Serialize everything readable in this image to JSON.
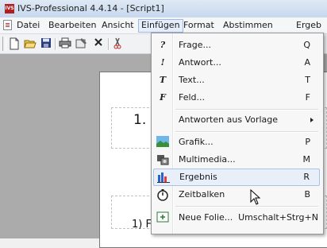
{
  "window": {
    "title": "IVS-Professional 4.4.14 - [Script1]",
    "app_icon_text": "IVS"
  },
  "menubar": {
    "items": [
      "Datei",
      "Bearbeiten",
      "Ansicht",
      "Einfügen",
      "Format",
      "Abstimmen",
      "Ergeb"
    ],
    "active": "Einfügen"
  },
  "toolbar": {
    "buttons": [
      "new-icon",
      "open-icon",
      "save-icon",
      "print-icon",
      "properties-icon",
      "delete-icon",
      "cut-icon"
    ]
  },
  "slide": {
    "heading": "1.",
    "bottom_label": "1) F"
  },
  "dropdown": {
    "items": [
      {
        "icon_glyph": "?",
        "icon": "question-icon",
        "label": "Frage...",
        "shortcut": "Q"
      },
      {
        "icon_glyph": "!",
        "icon": "exclamation-icon",
        "label": "Antwort...",
        "shortcut": "A"
      },
      {
        "icon_glyph": "T",
        "icon": "text-icon",
        "label": "Text...",
        "shortcut": "T"
      },
      {
        "icon_glyph": "F",
        "icon": "field-icon",
        "label": "Feld...",
        "shortcut": "F"
      },
      {
        "icon_glyph": "",
        "icon": "",
        "label": "Antworten aus Vorlage",
        "shortcut": "",
        "submenu": true
      },
      {
        "icon_glyph": "",
        "icon": "image-icon",
        "label": "Grafik...",
        "shortcut": "P"
      },
      {
        "icon_glyph": "",
        "icon": "multimedia-icon",
        "label": "Multimedia...",
        "shortcut": "M"
      },
      {
        "icon_glyph": "",
        "icon": "bar-chart-icon",
        "label": "Ergebnis",
        "shortcut": "R",
        "hover": true
      },
      {
        "icon_glyph": "",
        "icon": "stopwatch-icon",
        "label": "Zeitbalken",
        "shortcut": "B"
      },
      {
        "icon_glyph": "",
        "icon": "new-slide-icon",
        "label": "Neue Folie...",
        "shortcut": "Umschalt+Strg+N"
      }
    ]
  },
  "colors": {
    "accent_hover": "#e8eff9",
    "workspace_bg": "#ababab",
    "titlebar": "#c7d8ee"
  }
}
